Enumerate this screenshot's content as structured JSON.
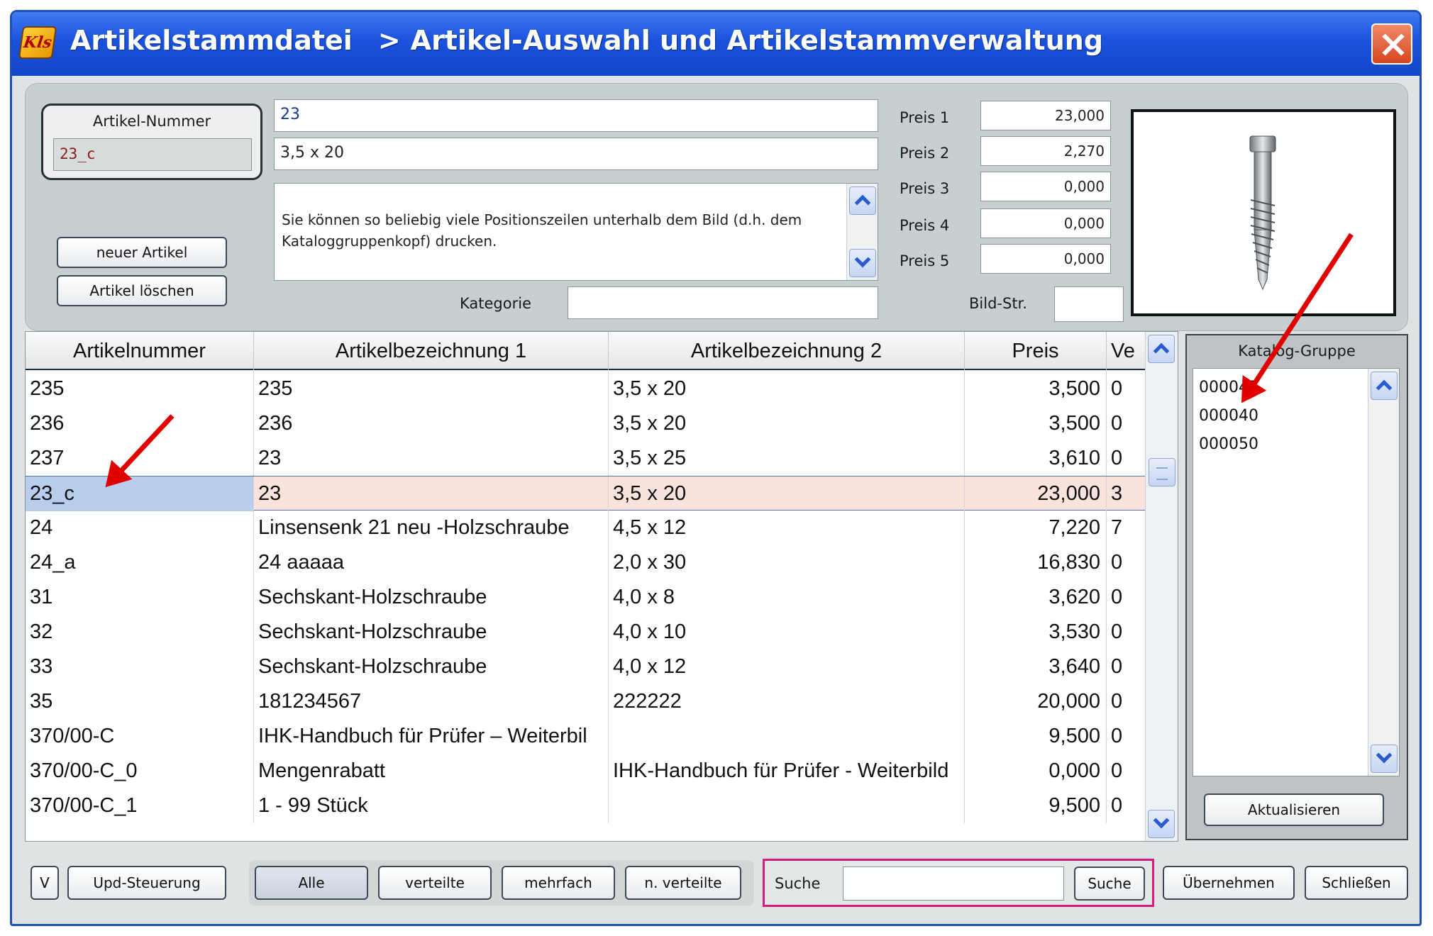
{
  "window": {
    "title_part1": "Artikelstammdatei",
    "title_sep": ">",
    "title_part2": "Artikel-Auswahl   und   Artikelstammverwaltung",
    "close_label": "×"
  },
  "detail": {
    "artnum_label": "Artikel-Nummer",
    "artnum_value": "23_c",
    "bez1_value": "23",
    "bez2_value": "3,5 x 20",
    "text_value": "Sie können so beliebig viele Positionszeilen unterhalb dem Bild  (d.h. dem Kataloggruppenkopf) drucken.",
    "kategorie_label": "Kategorie",
    "kategorie_value": "",
    "bild_label": "Bild-Str.",
    "bild_value": "",
    "btn_new": "neuer Artikel",
    "btn_delete": "Artikel  löschen",
    "prices": [
      {
        "label": "Preis 1",
        "value": "23,000"
      },
      {
        "label": "Preis 2",
        "value": "2,270"
      },
      {
        "label": "Preis 3",
        "value": "0,000"
      },
      {
        "label": "Preis 4",
        "value": "0,000"
      },
      {
        "label": "Preis 5",
        "value": "0,000"
      }
    ]
  },
  "table": {
    "columns": [
      "Artikelnummer",
      "Artikelbezeichnung 1",
      "Artikelbezeichnung 2",
      "Preis",
      "Ve"
    ],
    "rows": [
      [
        "235",
        "235",
        "3,5 x 20",
        "3,500",
        "0"
      ],
      [
        "236",
        "236",
        "3,5 x 20",
        "3,500",
        "0"
      ],
      [
        "237",
        "23",
        "3,5 x 25",
        "3,610",
        "0"
      ],
      [
        "23_c",
        "23",
        "3,5 x 20",
        "23,000",
        "3"
      ],
      [
        "24",
        "Linsensenk  21 neu  -Holzschraube",
        "4,5 x 12",
        "7,220",
        "7"
      ],
      [
        "24_a",
        "24 aaaaa",
        "2,0 x 30",
        "16,830",
        "0"
      ],
      [
        "31",
        "Sechskant-Holzschraube",
        "4,0 x 8",
        "3,620",
        "0"
      ],
      [
        "32",
        "Sechskant-Holzschraube",
        "4,0 x 10",
        "3,530",
        "0"
      ],
      [
        "33",
        "Sechskant-Holzschraube",
        "4,0 x 12",
        "3,640",
        "0"
      ],
      [
        "35",
        "181234567",
        "222222",
        "20,000",
        "0"
      ],
      [
        "370/00-C",
        "IHK-Handbuch für Prüfer – Weiterbil",
        "",
        "9,500",
        "0"
      ],
      [
        "370/00-C_0",
        "Mengenrabatt",
        "IHK-Handbuch für Prüfer - Weiterbild",
        "0,000",
        "0"
      ],
      [
        "370/00-C_1",
        "1 - 99 Stück",
        "",
        "9,500",
        "0"
      ]
    ],
    "selected_index": 3
  },
  "katalog": {
    "label": "Katalog-Gruppe",
    "items": [
      "000045",
      "000040",
      "000050"
    ],
    "btn_refresh": "Aktualisieren"
  },
  "bottom": {
    "btn_v": "V",
    "btn_upd": "Upd-Steuerung",
    "filters": [
      "Alle",
      "verteilte",
      "mehrfach",
      "n. verteilte"
    ],
    "search_label": "Suche",
    "search_value": "",
    "btn_search": "Suche",
    "btn_apply": "Übernehmen",
    "btn_close": "Schließen"
  },
  "colors": {
    "title_bar": "#1a52dc",
    "selected_row": "#f9e3dc",
    "selected_cell": "#b8ccec",
    "search_border": "#d81b7e",
    "annotation_arrow": "#e00000"
  }
}
